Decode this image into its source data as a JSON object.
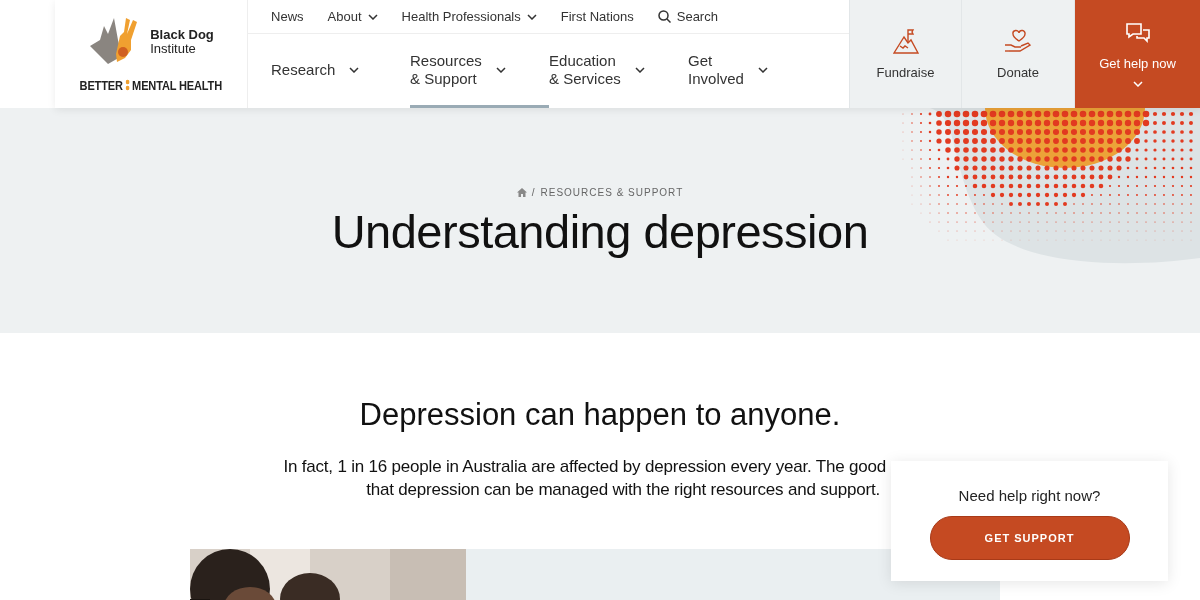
{
  "logo": {
    "name": [
      "Black Dog",
      "Institute"
    ],
    "tagline": [
      "BETTER",
      "MENTAL HEALTH"
    ]
  },
  "top_nav": [
    {
      "label": "News",
      "dropdown": false
    },
    {
      "label": "About",
      "dropdown": true
    },
    {
      "label": "Health Professionals",
      "dropdown": true
    },
    {
      "label": "First Nations",
      "dropdown": false
    }
  ],
  "search": {
    "label": "Search"
  },
  "main_nav": [
    {
      "lines": [
        "Research"
      ],
      "selected": false
    },
    {
      "lines": [
        "Resources",
        "& Support"
      ],
      "selected": true
    },
    {
      "lines": [
        "Education",
        "& Services"
      ],
      "selected": false
    },
    {
      "lines": [
        "Get",
        "Involved"
      ],
      "selected": false
    }
  ],
  "actions": [
    {
      "kind": "fundraise",
      "label": "Fundraise"
    },
    {
      "kind": "donate",
      "label": "Donate"
    },
    {
      "kind": "help",
      "label": "Get help now"
    }
  ],
  "breadcrumb": {
    "separator": "/",
    "items": [
      "RESOURCES & SUPPORT"
    ]
  },
  "title": "Understanding depression",
  "intro": {
    "heading": "Depression can happen to anyone.",
    "lines": [
      "In fact, 1 in 16 people in Australia are affected by depression every year. The good",
      "that depression can be managed with the right resources and support."
    ]
  },
  "help_card": {
    "question": "Need help right now?",
    "button": "GET SUPPORT"
  }
}
